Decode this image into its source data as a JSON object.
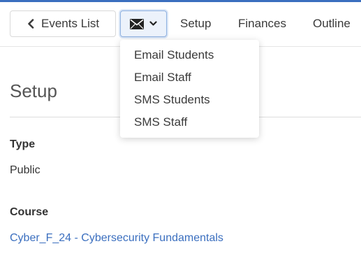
{
  "toolbar": {
    "back_label": "Events List",
    "nav": [
      "Setup",
      "Finances",
      "Outline"
    ]
  },
  "message_menu": {
    "items": [
      "Email Students",
      "Email Staff",
      "SMS Students",
      "SMS Staff"
    ]
  },
  "page": {
    "title": "Setup",
    "type_label": "Type",
    "type_value": "Public",
    "course_label": "Course",
    "course_value": "Cyber_F_24 - Cybersecurity Fundamentals"
  },
  "colors": {
    "accent": "#3b6fbf",
    "link": "#3b6fbf"
  },
  "icons": {
    "back": "chevron-left-icon",
    "message": "envelope-icon",
    "dropdown": "chevron-down-icon"
  }
}
